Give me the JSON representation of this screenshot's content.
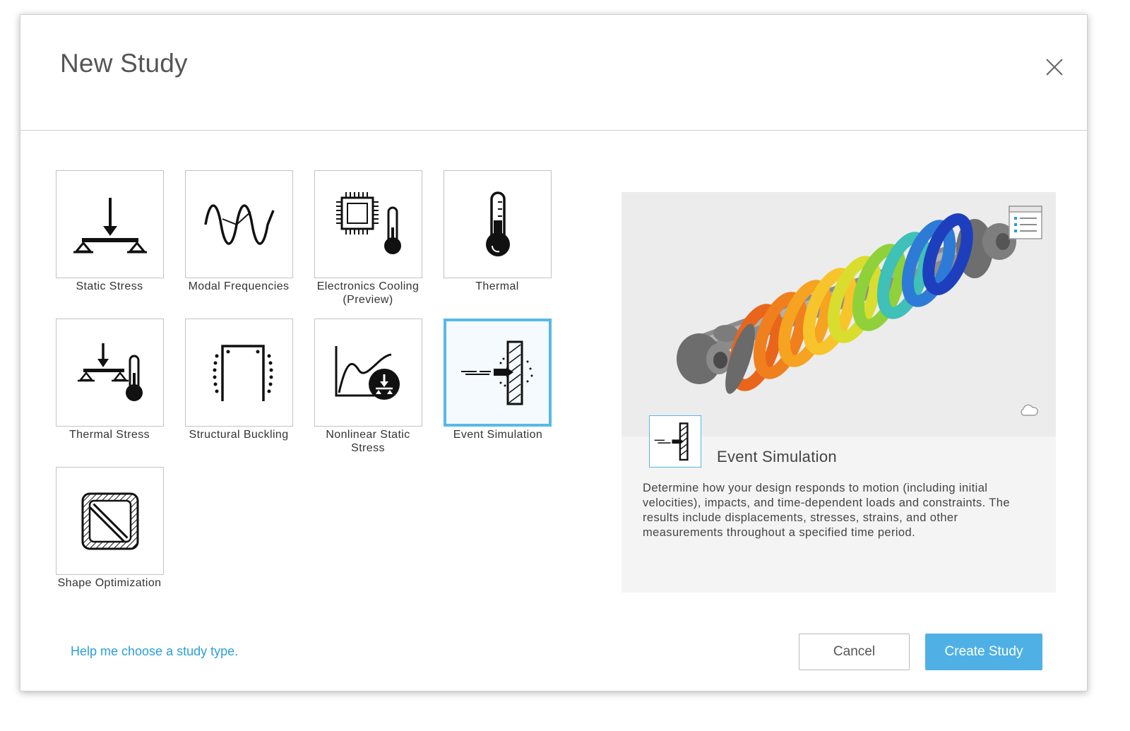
{
  "dialog": {
    "title": "New Study"
  },
  "study_types": [
    {
      "id": "static-stress",
      "label": "Static Stress",
      "icon": "static-stress-icon",
      "selected": false
    },
    {
      "id": "modal-frequencies",
      "label": "Modal Frequencies",
      "icon": "modal-frequencies-icon",
      "selected": false
    },
    {
      "id": "electronics-cooling",
      "label": "Electronics Cooling\n(Preview)",
      "icon": "electronics-cooling-icon",
      "selected": false
    },
    {
      "id": "thermal",
      "label": "Thermal",
      "icon": "thermometer-icon",
      "selected": false
    },
    {
      "id": "thermal-stress",
      "label": "Thermal Stress",
      "icon": "thermal-stress-icon",
      "selected": false
    },
    {
      "id": "structural-buckling",
      "label": "Structural Buckling",
      "icon": "structural-buckling-icon",
      "selected": false
    },
    {
      "id": "nonlinear-static-stress",
      "label": "Nonlinear Static\nStress",
      "icon": "nonlinear-static-stress-icon",
      "selected": false
    },
    {
      "id": "event-simulation",
      "label": "Event Simulation",
      "icon": "event-simulation-icon",
      "selected": true
    },
    {
      "id": "shape-optimization",
      "label": "Shape Optimization",
      "icon": "shape-optimization-icon",
      "selected": false
    }
  ],
  "preview": {
    "title": "Event Simulation",
    "description": "Determine how your design responds to motion (including initial velocities), impacts, and time-dependent loads and constraints. The results include displacements, stresses, strains, and other measurements throughout a specified time period.",
    "image_icon": "shock-absorber-simulation-image",
    "list_icon": "list-view-icon",
    "cloud_icon": "cloud-icon"
  },
  "footer": {
    "help_link": "Help me choose a study type.",
    "cancel_label": "Cancel",
    "create_label": "Create Study"
  },
  "colors": {
    "accent": "#4fb0e6",
    "link": "#2b9fd9",
    "selected_border": "#58b8e8"
  }
}
